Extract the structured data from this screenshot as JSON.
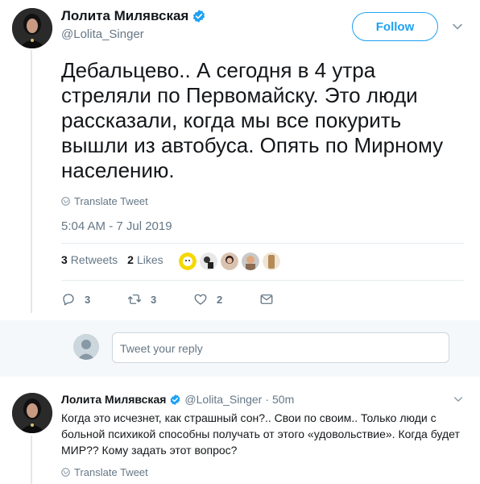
{
  "tweet": {
    "display_name": "Лолита Милявская",
    "handle": "@Lolita_Singer",
    "follow_label": "Follow",
    "text": "Дебальцево.. А сегодня в 4 утра стреляли по Первомайску. Это люди рассказали, когда мы все покурить вышли из автобуса. Опять по Мирному населению.",
    "translate_label": "Translate Tweet",
    "timestamp": "5:04 AM - 7 Jul 2019",
    "retweets_count": "3",
    "retweets_label": "Retweets",
    "likes_count": "2",
    "likes_label": "Likes",
    "actions": {
      "reply_count": "3",
      "retweet_count": "3",
      "like_count": "2"
    }
  },
  "reply_box": {
    "placeholder": "Tweet your reply"
  },
  "reply_tweet": {
    "display_name": "Лолита Милявская",
    "handle": "@Lolita_Singer",
    "separator": "·",
    "time": "50m",
    "text": "Когда это исчезнет, как страшный сон?.. Свои по своим.. Только люди с больной психикой способны получать от этого «удовольствие». Когда будет МИР?? Кому задать этот вопрос?",
    "translate_label": "Translate Tweet"
  },
  "colors": {
    "accent": "#1da1f2",
    "muted": "#657786",
    "text": "#14171a",
    "divider": "#e6ecf0"
  },
  "icons": [
    "verified-badge-icon",
    "chevron-down-icon",
    "globe-icon",
    "reply-icon",
    "retweet-icon",
    "like-icon",
    "dm-icon"
  ]
}
